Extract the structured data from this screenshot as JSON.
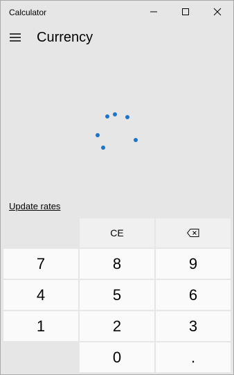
{
  "window": {
    "title": "Calculator"
  },
  "header": {
    "mode": "Currency"
  },
  "update_link": "Update rates",
  "keypad": {
    "ce": "CE",
    "seven": "7",
    "eight": "8",
    "nine": "9",
    "four": "4",
    "five": "5",
    "six": "6",
    "one": "1",
    "two": "2",
    "three": "3",
    "zero": "0",
    "decimal": "."
  },
  "icons": {
    "menu": "hamburger-menu-icon",
    "minimize": "minimize-icon",
    "maximize": "maximize-icon",
    "close": "close-icon",
    "backspace": "backspace-icon",
    "loading": "loading-spinner"
  },
  "colors": {
    "background": "#e6e6e6",
    "key": "#fafafa",
    "function_key": "#f0f0f0",
    "accent": "#1e75c8"
  }
}
